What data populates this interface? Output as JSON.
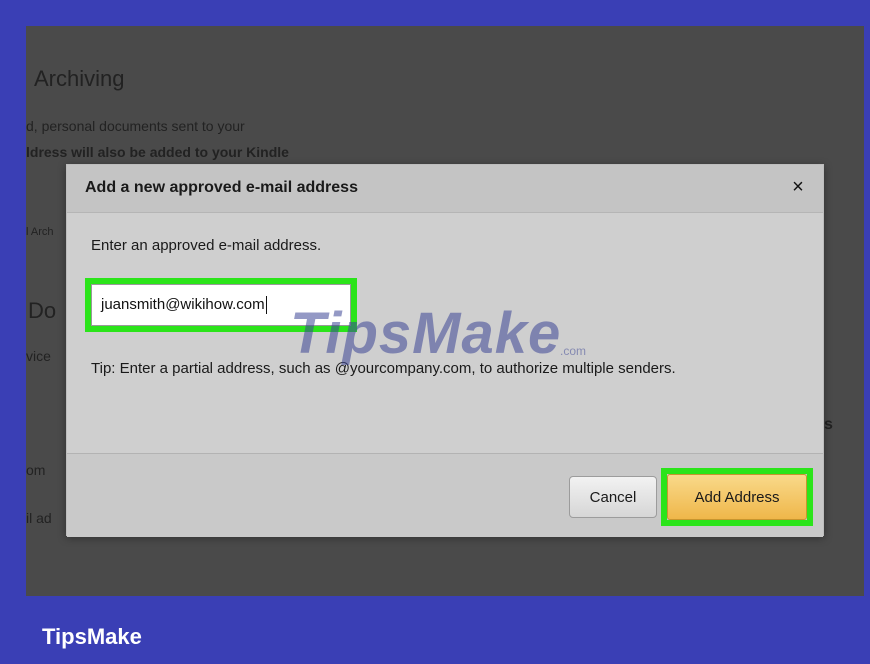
{
  "background": {
    "heading": "Archiving",
    "line1": "d, personal documents sent to your",
    "line2": "ldress will also be added to your Kindle",
    "frag_arch": "l Arch",
    "frag_do": "Do",
    "frag_vice": "vice",
    "frag_s": "s",
    "frag_om": "om",
    "frag_ad": "il ad"
  },
  "modal": {
    "title": "Add a new approved e-mail address",
    "close_label": "×",
    "prompt": "Enter an approved e-mail address.",
    "email_value": "juansmith@wikihow.com",
    "tip": "Tip: Enter a partial address, such as @yourcompany.com, to authorize multiple senders.",
    "cancel_label": "Cancel",
    "add_label": "Add Address"
  },
  "watermark": {
    "text": "TipsMake",
    "sub": ".com"
  },
  "brand": "TipsMake",
  "colors": {
    "frame_border": "#3a3fb5",
    "highlight": "#2be41a",
    "add_button": "#efb74a"
  }
}
